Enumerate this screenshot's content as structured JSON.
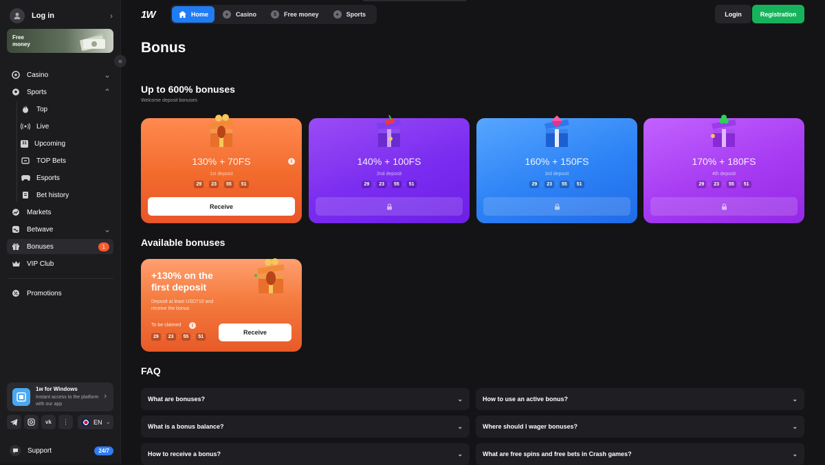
{
  "sidebar": {
    "login_label": "Log in",
    "free_money_label": "Free money",
    "collapse_icon": "«",
    "items": [
      {
        "label": "Casino",
        "icon": "casino-icon"
      },
      {
        "label": "Sports",
        "icon": "sports-icon"
      },
      {
        "label": "Top",
        "icon": "fire-icon"
      },
      {
        "label": "Live",
        "icon": "live-icon"
      },
      {
        "label": "Upcoming",
        "icon": "calendar-icon",
        "icon_text": "31"
      },
      {
        "label": "TOP Bets",
        "icon": "top-bets-icon"
      },
      {
        "label": "Esports",
        "icon": "esports-icon"
      },
      {
        "label": "Bet history",
        "icon": "history-icon"
      },
      {
        "label": "Markets",
        "icon": "markets-icon"
      },
      {
        "label": "Betwave",
        "icon": "betwave-icon"
      },
      {
        "label": "Bonuses",
        "icon": "gift-icon",
        "badge": "1"
      },
      {
        "label": "VIP Club",
        "icon": "crown-icon"
      },
      {
        "label": "Promotions",
        "icon": "promotions-icon"
      }
    ],
    "windows_app": {
      "title": "1w for Windows",
      "desc": "Instant access to the platform with our app"
    },
    "language": "EN",
    "support_label": "Support",
    "support_badge": "24/7"
  },
  "topbar": {
    "logo": "1W",
    "tabs": [
      {
        "label": "Home",
        "icon": "home-icon",
        "active": true
      },
      {
        "label": "Casino",
        "icon": "casino-icon"
      },
      {
        "label": "Free money",
        "icon": "dollar-icon"
      },
      {
        "label": "Sports",
        "icon": "football-icon"
      }
    ],
    "login_label": "Login",
    "register_label": "Registration"
  },
  "page": {
    "title": "Bonus",
    "welcome_heading": "Up to 600% bonuses",
    "welcome_sub": "Welcome deposit bonuses",
    "cards": [
      {
        "amount": "130% + 70FS",
        "deposit": "1st deposit",
        "timer": [
          "29",
          "23",
          "55",
          "51"
        ],
        "button": "Receive",
        "locked": false,
        "color": "#f26a2c"
      },
      {
        "amount": "140% + 100FS",
        "deposit": "2nd deposit",
        "timer": [
          "29",
          "23",
          "55",
          "51"
        ],
        "locked": true,
        "color": "#7a2cf0"
      },
      {
        "amount": "160% + 150FS",
        "deposit": "3rd deposit",
        "timer": [
          "29",
          "23",
          "55",
          "51"
        ],
        "locked": true,
        "color": "#2d82f5"
      },
      {
        "amount": "170% + 180FS",
        "deposit": "4th deposit",
        "timer": [
          "29",
          "23",
          "55",
          "51"
        ],
        "locked": true,
        "color": "#a63bf2"
      }
    ],
    "available_heading": "Available bonuses",
    "available": {
      "title": "+130% on the first deposit",
      "desc": "Deposit at least USD†10 and receive the bonus",
      "claim_label": "To be claimed",
      "timer": [
        "29",
        "23",
        "55",
        "51"
      ],
      "button": "Receive"
    },
    "faq_heading": "FAQ",
    "faq": [
      "What are bonuses?",
      "How to use an active bonus?",
      "What is a bonus balance?",
      "Where should I wager bonuses?",
      "How to receive a bonus?",
      "What are free spins and free bets in Crash games?"
    ]
  }
}
